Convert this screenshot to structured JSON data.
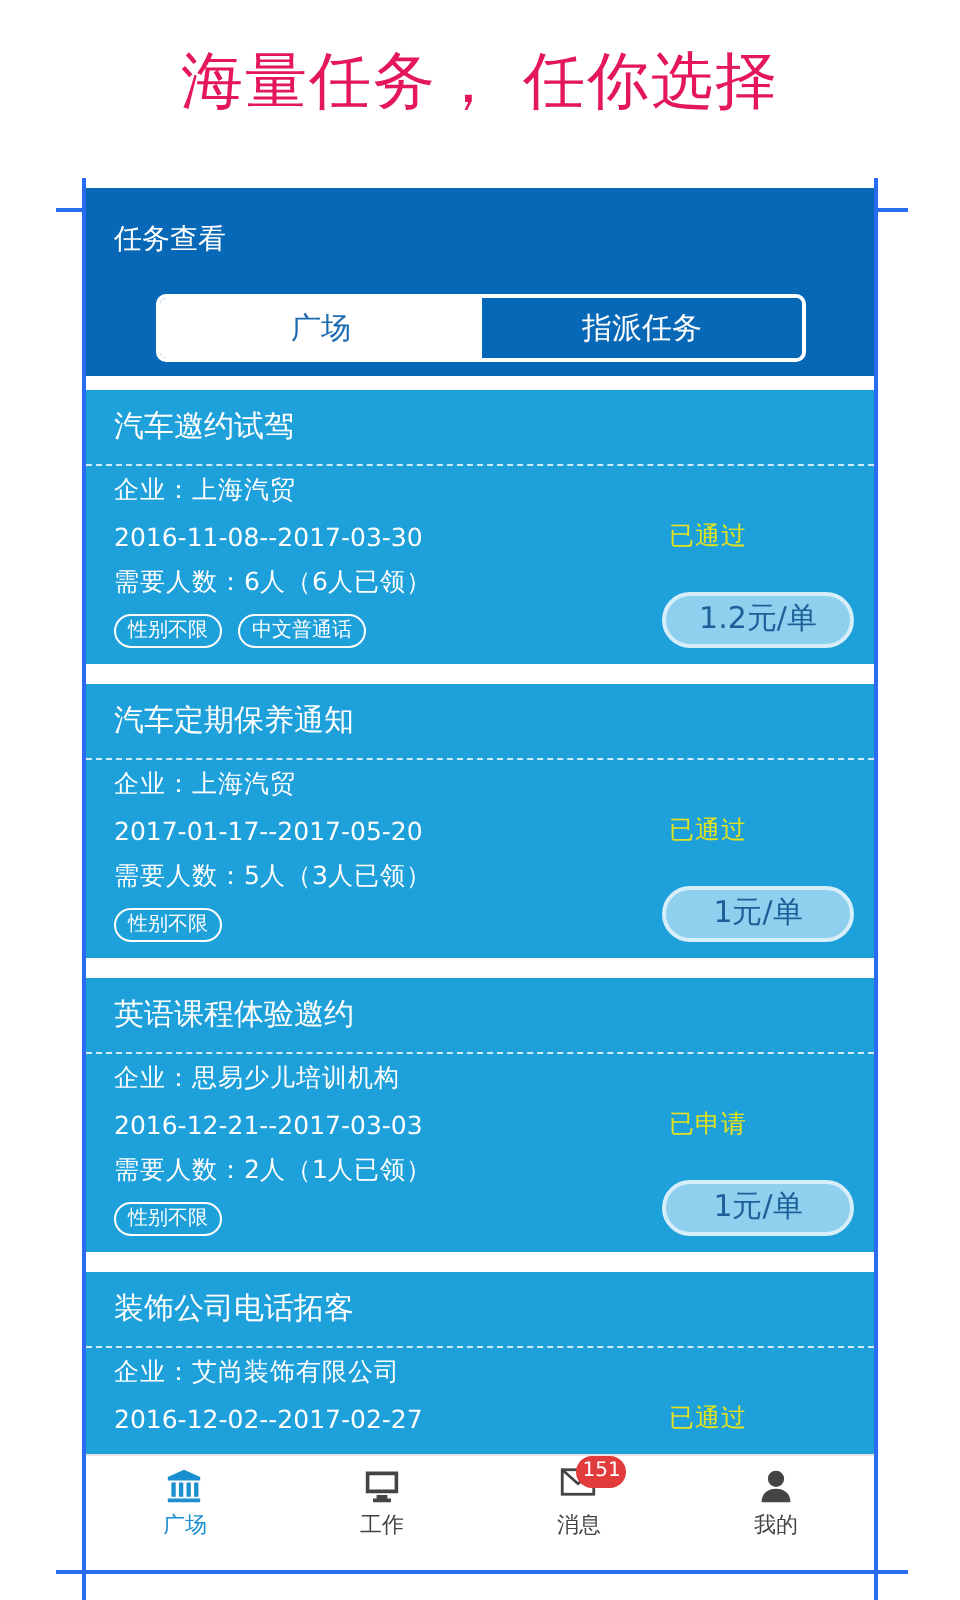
{
  "headline": "海量任务， 任你选择",
  "header": {
    "title": "任务查看"
  },
  "tabs": [
    {
      "label": "广场",
      "selected": true
    },
    {
      "label": "指派任务",
      "selected": false
    }
  ],
  "tasks": [
    {
      "title": "汽车邀约试驾",
      "company": "企业：上海汽贸",
      "dates": "2016-11-08--2017-03-30",
      "status": "已通过",
      "headcount": "需要人数：6人（6人已领）",
      "tags": [
        "性别不限",
        "中文普通话"
      ],
      "price": "1.2元/单"
    },
    {
      "title": "汽车定期保养通知",
      "company": "企业：上海汽贸",
      "dates": "2017-01-17--2017-05-20",
      "status": "已通过",
      "headcount": "需要人数：5人（3人已领）",
      "tags": [
        "性别不限"
      ],
      "price": "1元/单"
    },
    {
      "title": "英语课程体验邀约",
      "company": "企业：思易少儿培训机构",
      "dates": "2016-12-21--2017-03-03",
      "status": "已申请",
      "headcount": "需要人数：2人（1人已领）",
      "tags": [
        "性别不限"
      ],
      "price": "1元/单"
    },
    {
      "title": "装饰公司电话拓客",
      "company": "企业：艾尚装饰有限公司",
      "dates": "2016-12-02--2017-02-27",
      "status": "已通过"
    }
  ],
  "nav": [
    {
      "label": "广场",
      "kind": "bank",
      "selected": true
    },
    {
      "label": "工作",
      "kind": "monitor",
      "selected": false
    },
    {
      "label": "消息",
      "kind": "mail",
      "selected": false,
      "badge": "151"
    },
    {
      "label": "我的",
      "kind": "person",
      "selected": false
    }
  ]
}
